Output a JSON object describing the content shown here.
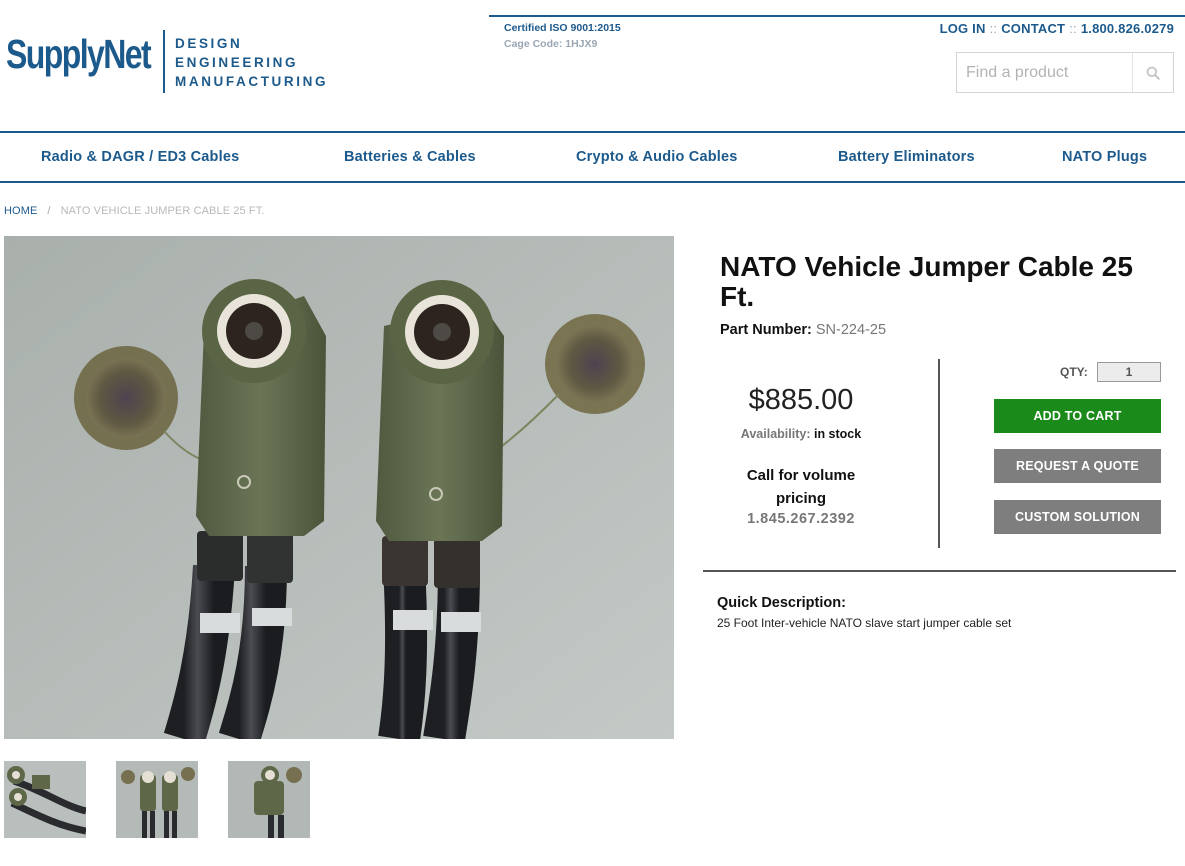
{
  "brand": {
    "logo_text": "SupplyNet",
    "tagline": [
      "DESIGN",
      "ENGINEERING",
      "MANUFACTURING"
    ],
    "color": "#1d5a8c"
  },
  "cert": {
    "line1": "Certified ISO 9001:2015",
    "line2": "Cage Code: 1HJX9"
  },
  "top_links": {
    "login": "LOG IN",
    "contact": "CONTACT",
    "phone": "1.800.826.0279",
    "separator": "::"
  },
  "search": {
    "placeholder": "Find a product",
    "icon": "search-icon"
  },
  "nav": [
    "Radio & DAGR / ED3 Cables",
    "Batteries & Cables",
    "Crypto & Audio Cables",
    "Battery Eliminators",
    "NATO Plugs"
  ],
  "breadcrumb": {
    "home": "HOME",
    "separator": "/",
    "current": "NATO VEHICLE JUMPER CABLE 25 FT."
  },
  "product": {
    "title": "NATO Vehicle Jumper Cable 25 Ft.",
    "part_number_label": "Part Number:",
    "part_number": "SN-224-25",
    "price": "$885.00",
    "availability_label": "Availability:",
    "availability": "in stock",
    "volume_text": "Call for volume pricing",
    "volume_phone": "1.845.267.2392",
    "qty_label": "QTY:",
    "qty_value": "1",
    "add_to_cart": "ADD TO CART",
    "request_quote": "REQUEST A QUOTE",
    "custom_solution": "CUSTOM SOLUTION",
    "quick_desc_title": "Quick Description:",
    "quick_desc": "25 Foot Inter-vehicle NATO slave start jumper cable set"
  },
  "colors": {
    "cart_button": "#1a8a1a",
    "secondary_button": "#7e7e7e",
    "nav_text": "#1d5a8c"
  }
}
